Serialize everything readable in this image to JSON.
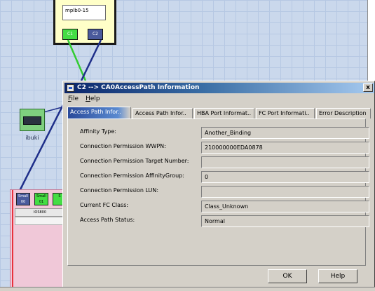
{
  "background": {
    "switch": {
      "field_value": "mplb0-15",
      "ports": [
        "C1",
        "C2"
      ]
    },
    "server": {
      "label": "ibuki"
    },
    "storage": {
      "ca_ports": [
        "Small\n00",
        "Small\n01",
        "S"
      ],
      "band_label": "IOS800"
    }
  },
  "dialog": {
    "title": "C2  --> CA0AccessPath Information",
    "close_label": "x",
    "menu": [
      {
        "mnemonic": "F",
        "rest": "ile"
      },
      {
        "mnemonic": "H",
        "rest": "elp"
      }
    ],
    "tabs": [
      "Access Path Infor..",
      "Access Path Infor..",
      "HBA Port Informat..",
      "FC Port Informati..",
      "Error Description"
    ],
    "active_tab_index": 0,
    "fields": [
      {
        "label": "Affinity Type:",
        "value": "Another_Binding"
      },
      {
        "label": "Connection Permission WWPN:",
        "value": "210000000EDA0878"
      },
      {
        "label": "Connection Permission Target Number:",
        "value": ""
      },
      {
        "label": "Connection Permission AffinityGroup:",
        "value": "0"
      },
      {
        "label": "Connection Permission LUN:",
        "value": ""
      },
      {
        "label": "Current FC Class:",
        "value": "Class_Unknown"
      },
      {
        "label": "Access Path Status:",
        "value": "Normal"
      }
    ],
    "buttons": {
      "ok": "OK",
      "help": "Help"
    }
  },
  "colors": {
    "title_active": "#0a246a",
    "dialog_face": "#d4d0c8",
    "port_green": "#44dd44",
    "port_blue": "#4a5a9c"
  }
}
